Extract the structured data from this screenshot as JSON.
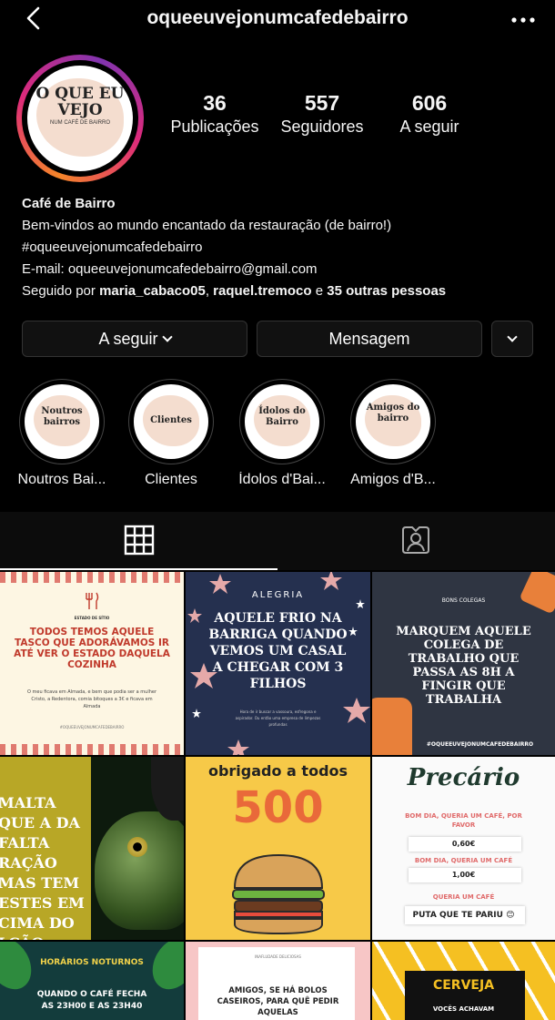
{
  "header": {
    "username": "oqueeuvejonumcafedebairro"
  },
  "avatar": {
    "title": "O QUE EU VEJO",
    "subtitle": "NUM CAFÉ DE BAIRRO"
  },
  "stats": [
    {
      "value": "36",
      "label": "Publicações"
    },
    {
      "value": "557",
      "label": "Seguidores"
    },
    {
      "value": "606",
      "label": "A seguir"
    }
  ],
  "bio": {
    "name": "Café de Bairro",
    "line1": "Bem-vindos ao mundo encantado da restauração (de bairro!)",
    "hashtag": "#oqueeuvejonumcafedebairro",
    "email": "E-mail: oqueeuvejonumcafedebairro@gmail.com",
    "followed_prefix": "Seguido por ",
    "follower1": "maria_cabaco05",
    "sep": ", ",
    "follower2": "raquel.tremoco",
    "and": " e ",
    "others": "35 outras pessoas"
  },
  "buttons": {
    "following": "A seguir",
    "message": "Mensagem"
  },
  "highlights": [
    {
      "cover": "Noutros bairros",
      "label": "Noutros Bai..."
    },
    {
      "cover": "Clientes",
      "label": "Clientes"
    },
    {
      "cover": "Ídolos do Bairro",
      "label": "Ídolos d'Bai..."
    },
    {
      "cover": "Amigos do bairro",
      "label": "Amigos d'B..."
    }
  ],
  "posts": {
    "p1": {
      "small": "ESTADO DE SÍTIO",
      "title": "TODOS TEMOS AQUELE TASCO QUE ADORÁVAMOS IR ATÉ VER O ESTADO DAQUELA COZINHA",
      "body": "O meu ficava em Almada, e bem que podia ser a mulher Cristo, a Redentora, comia bitoques a 3€ e ficava em Almada",
      "tag": "#OQUEEUVEJONUMCAFEDEBAIRRO"
    },
    "p2": {
      "small": "ALEGRIA",
      "title": "AQUELE FRIO NA BARRIGA QUANDO VEMOS UM CASAL A CHEGAR COM 3 FILHOS",
      "body": "Hora de ir buscar a vassoura, esfregona e aspirador. Ou então uma empresa de limpezas profundas"
    },
    "p3": {
      "small": "BONS COLEGAS",
      "title": "MARQUEM AQUELE COLEGA DE TRABALHO QUE PASSA AS 8H A FINGIR QUE TRABALHA",
      "tag": "#OQUEEUVEJONUMCAFEDEBAIRRO"
    },
    "p4": {
      "text": "MALTA QUE A DA FALTA RAÇÃO MAS TEM ESTES EM CIMA DO LCÃO"
    },
    "p5": {
      "title": "obrigado a todos",
      "number": "500"
    },
    "p6": {
      "title": "Precário",
      "q1": "BOM DIA, QUERIA UM CAFÉ, POR FAVOR",
      "v1": "0,60€",
      "q2": "BOM DIA, QUERIA UM CAFÉ",
      "v2": "1,00€",
      "q3": "QUERIA UM CAFÉ",
      "v3": "PUTA QUE TE PARIU 😊"
    },
    "p7": {
      "title": "HORÁRIOS NOTURNOS",
      "body": "QUANDO O CAFÉ FECHA AS 23H00 E AS 23H40"
    },
    "p8": {
      "small": "INAFLUDADE DELICIOSAS",
      "body": "AMIGOS, SE HÁ BOLOS CASEIROS, PARA QUÊ PEDIR AQUELAS"
    },
    "p9": {
      "title": "CERVEJA",
      "body": "VOCÊS ACHAVAM"
    }
  }
}
